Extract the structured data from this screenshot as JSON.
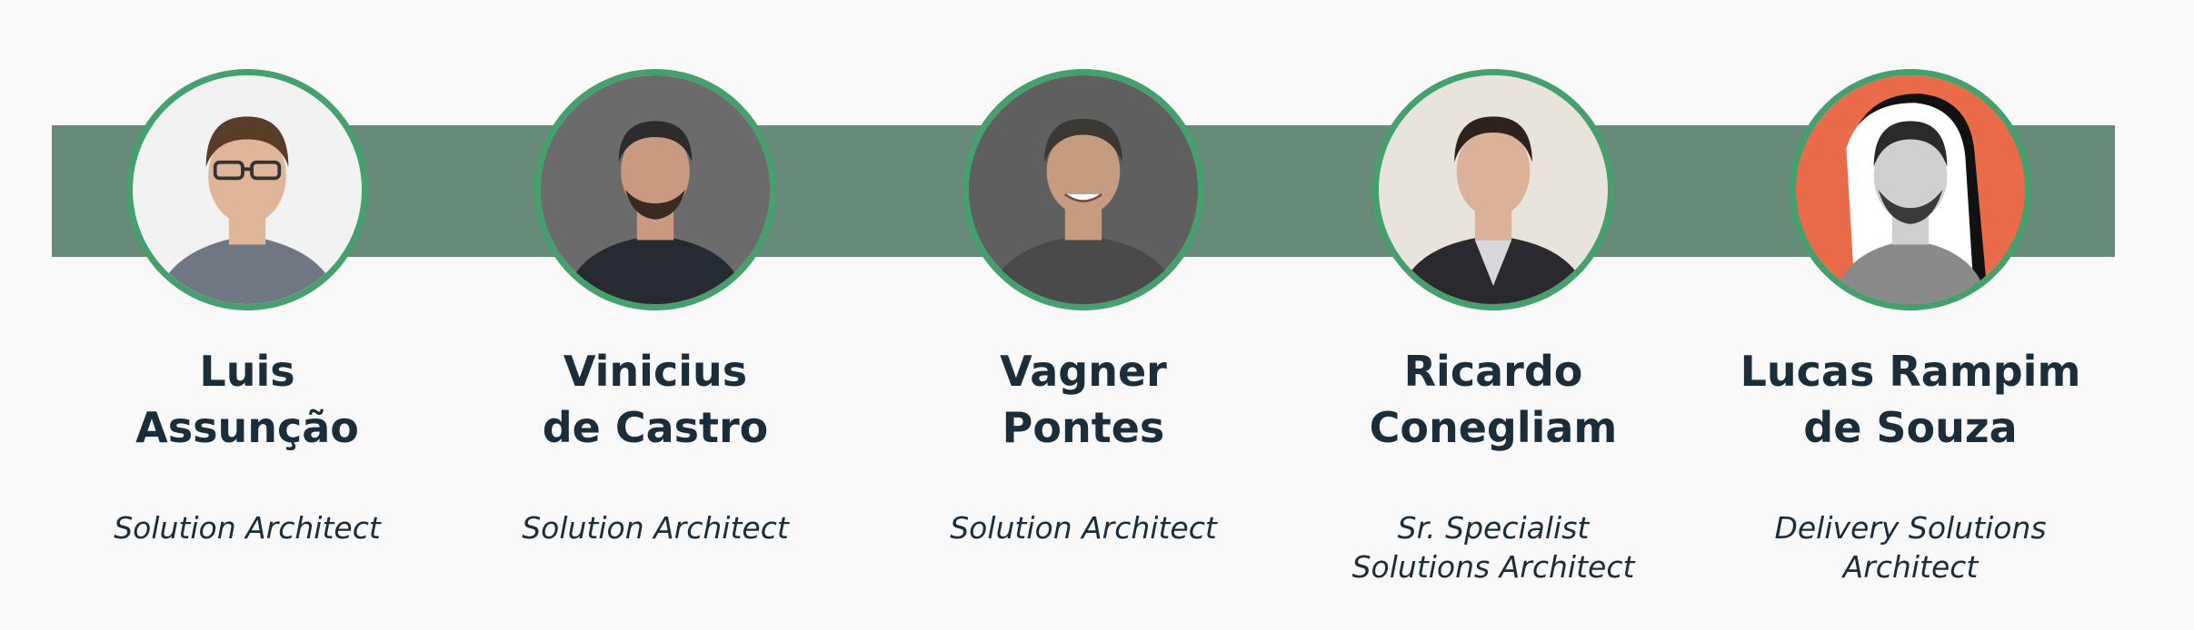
{
  "team": [
    {
      "name_line1": "Luis",
      "name_line2": "Assunção",
      "role_line1": "Solution Architect",
      "role_line2": "",
      "photo_bg": "#f2f2f2",
      "skin": "#e0b69a",
      "hair": "#5a3d28",
      "shirt": "#6f7783"
    },
    {
      "name_line1": "Vinicius",
      "name_line2": "de Castro",
      "role_line1": "Solution Architect",
      "role_line2": "",
      "photo_bg": "#6b6b6b",
      "skin": "#c99a7f",
      "hair": "#2c2c2c",
      "shirt": "#262a31"
    },
    {
      "name_line1": "Vagner",
      "name_line2": "Pontes",
      "role_line1": "Solution Architect",
      "role_line2": "",
      "photo_bg": "#5f5f5f",
      "skin": "#c69c80",
      "hair": "#3b3733",
      "shirt": "#4a4a4a"
    },
    {
      "name_line1": "Ricardo",
      "name_line2": "Conegliam",
      "role_line1": "Sr. Specialist",
      "role_line2": "Solutions Architect",
      "photo_bg": "#e8e4dc",
      "skin": "#dcb199",
      "hair": "#2e231c",
      "shirt": "#2a2a2e"
    },
    {
      "name_line1": "Lucas Rampim",
      "name_line2": "de Souza",
      "role_line1": "Delivery Solutions",
      "role_line2": "Architect",
      "photo_bg": "#e96b4a",
      "skin": "#cfcfcf",
      "hair": "#2a2a2a",
      "shirt": "#8a8a8a"
    }
  ],
  "colors": {
    "band": "#688a79",
    "ring": "#45a06e",
    "text": "#1c2d3a",
    "background": "#f9f9f9"
  }
}
